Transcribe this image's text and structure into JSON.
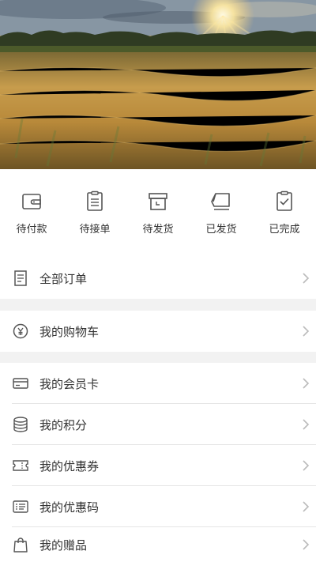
{
  "order_status": [
    {
      "label": "待付款",
      "icon": "wallet-icon"
    },
    {
      "label": "待接单",
      "icon": "clipboard-list-icon"
    },
    {
      "label": "待发货",
      "icon": "box-icon"
    },
    {
      "label": "已发货",
      "icon": "truck-icon"
    },
    {
      "label": "已完成",
      "icon": "clipboard-check-icon"
    }
  ],
  "menu": {
    "all_orders": {
      "label": "全部订单",
      "icon": "document-icon"
    },
    "cart": {
      "label": "我的购物车",
      "icon": "yuan-coin-icon"
    },
    "member_card": {
      "label": "我的会员卡",
      "icon": "card-icon"
    },
    "points": {
      "label": "我的积分",
      "icon": "coins-stack-icon"
    },
    "coupons": {
      "label": "我的优惠券",
      "icon": "ticket-icon"
    },
    "promo_code": {
      "label": "我的优惠码",
      "icon": "code-card-icon"
    },
    "gifts": {
      "label": "我的赠品",
      "icon": "gift-bag-icon"
    }
  },
  "colors": {
    "icon": "#555555",
    "arrow": "#bbbbbb",
    "background": "#f2f2f2"
  }
}
